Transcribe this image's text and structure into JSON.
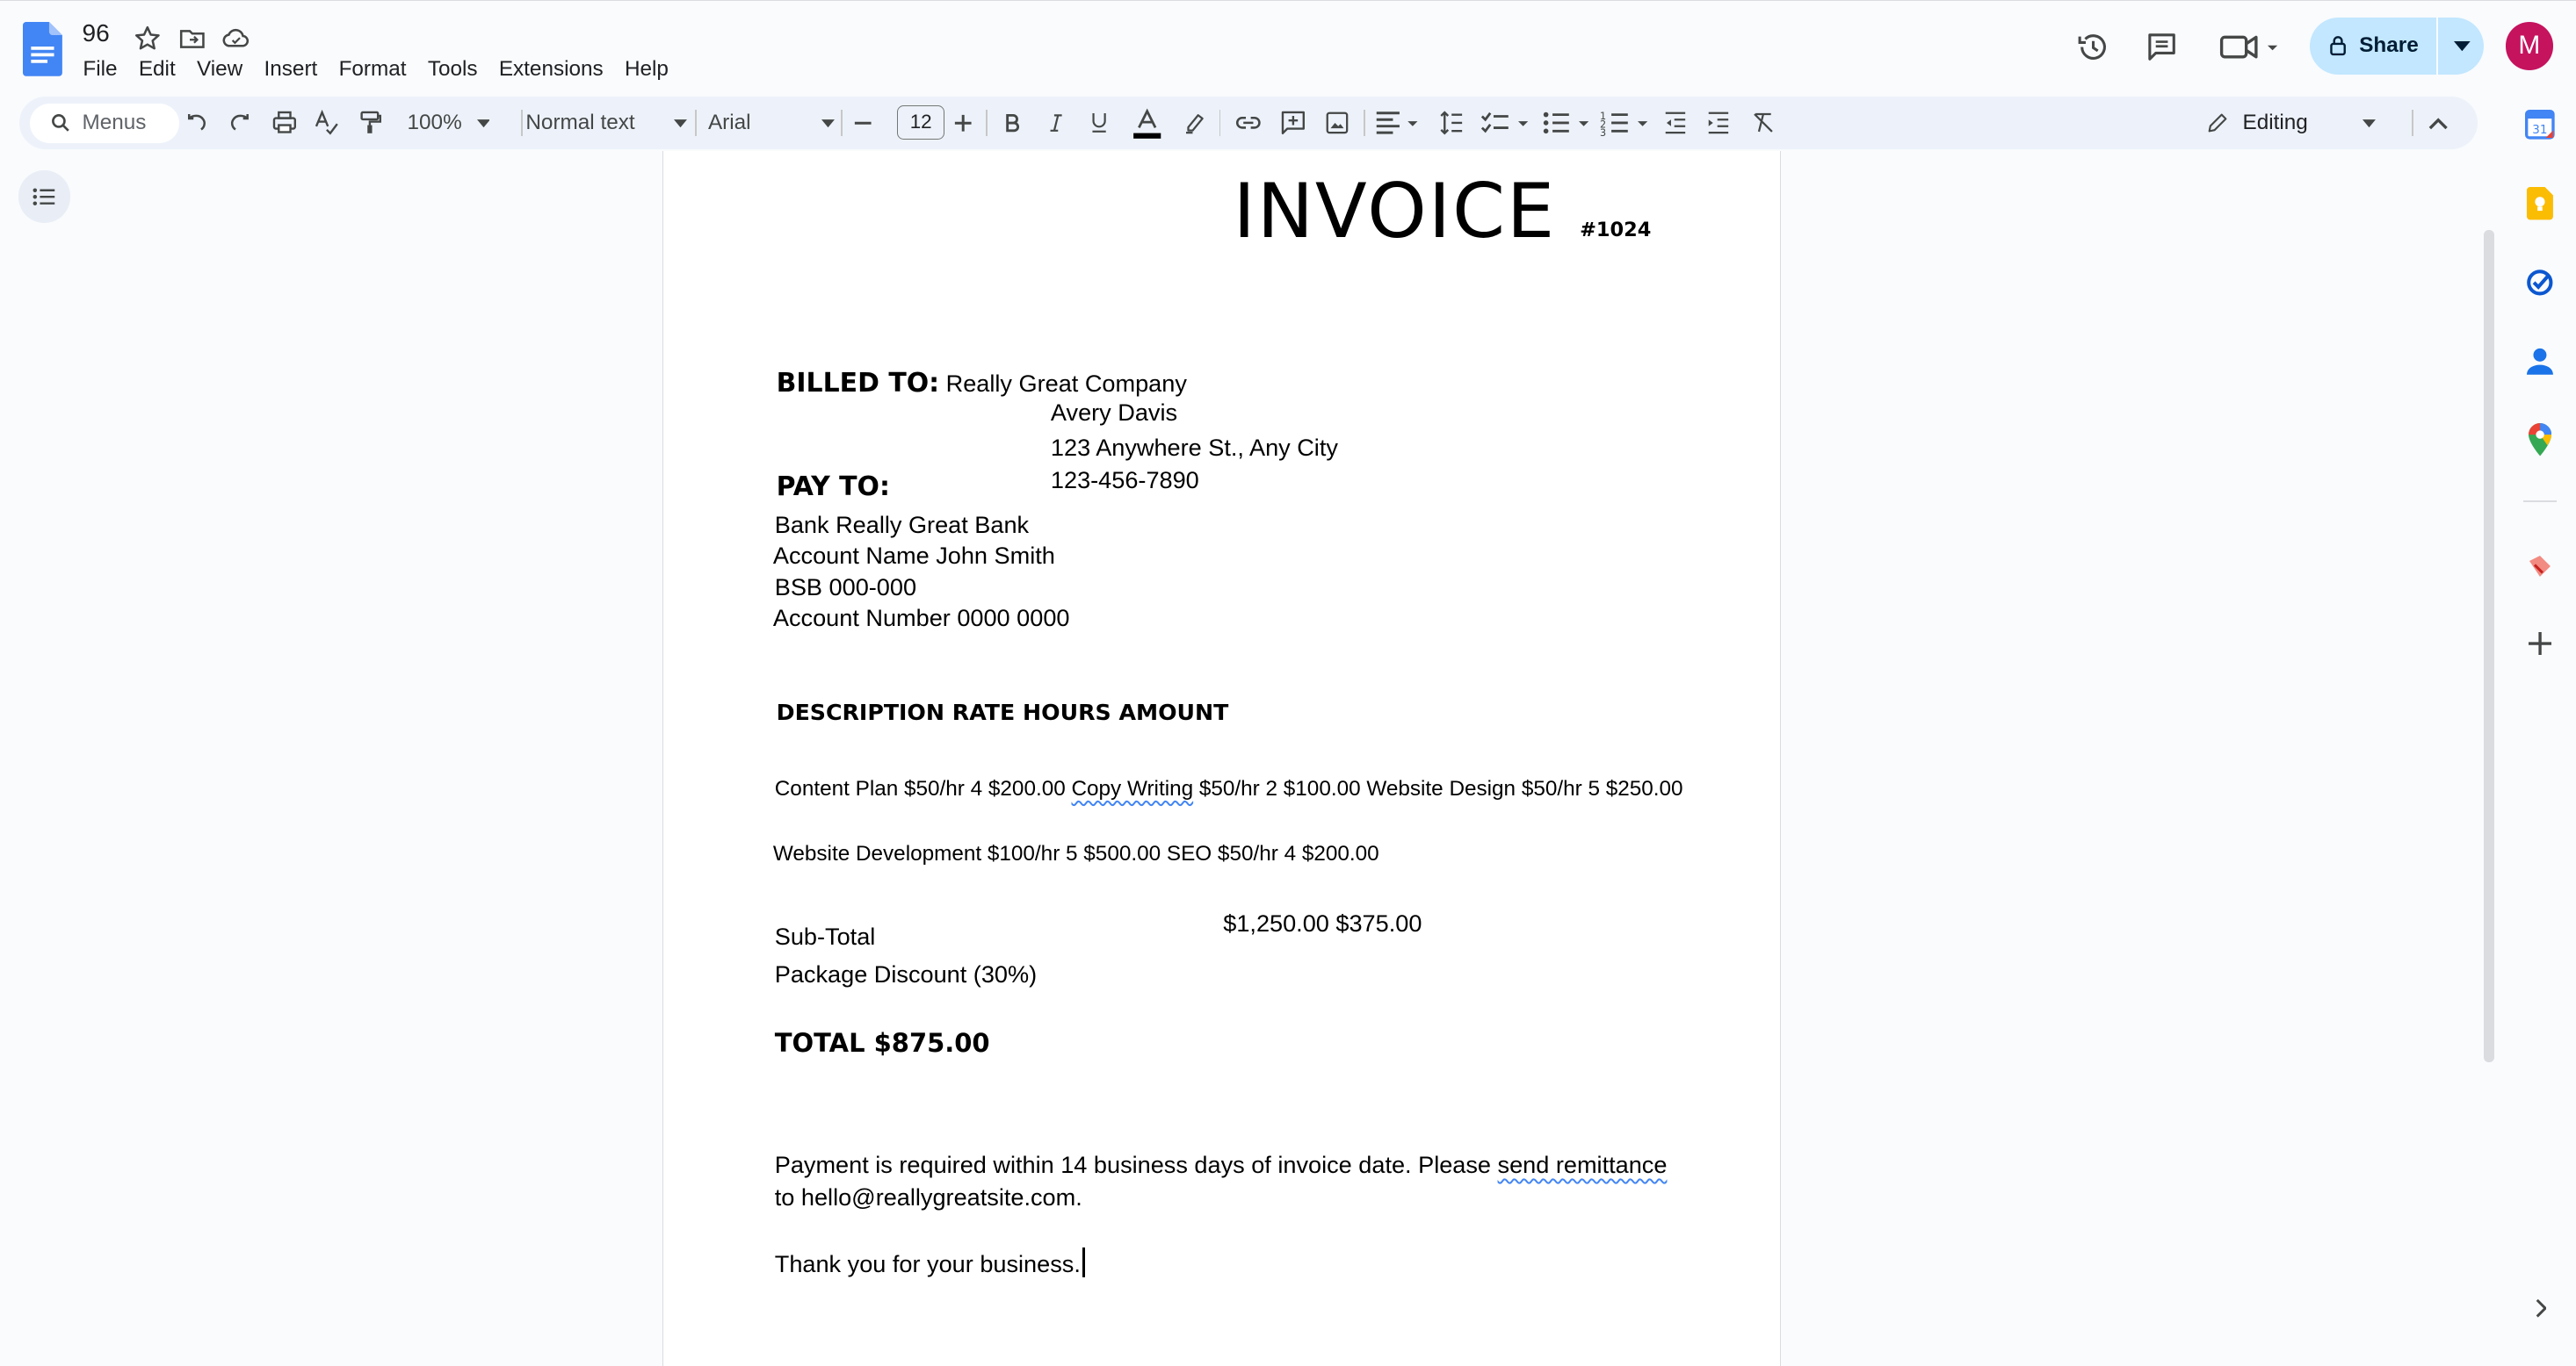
{
  "app": {
    "doc_title": "96",
    "menu": [
      "File",
      "Edit",
      "View",
      "Insert",
      "Format",
      "Tools",
      "Extensions",
      "Help"
    ],
    "share_label": "Share",
    "avatar_initial": "M",
    "colors": {
      "accent": "#c2e7ff",
      "avatar": "#c5135e",
      "docs_blue": "#4285f4"
    }
  },
  "toolbar": {
    "search_label": "Menus",
    "zoom": "100%",
    "style": "Normal text",
    "font": "Arial",
    "font_size": "12",
    "mode": "Editing",
    "icons": [
      "undo-icon",
      "redo-icon",
      "print-icon",
      "spellcheck-icon",
      "paint-format-icon",
      "bold-icon",
      "italic-icon",
      "underline-icon",
      "text-color-icon",
      "highlight-icon",
      "link-icon",
      "comment-icon",
      "image-icon",
      "align-icon",
      "line-spacing-icon",
      "checklist-icon",
      "bulleted-list-icon",
      "numbered-list-icon",
      "decrease-indent-icon",
      "increase-indent-icon",
      "clear-formatting-icon"
    ]
  },
  "document": {
    "title": "INVOICE",
    "number": "#1024",
    "billed_label": "BILLED TO:",
    "billed_company": "Really Great Company",
    "billed_name": "Avery Davis",
    "billed_address": "123 Anywhere St., Any City",
    "billed_phone": "123-456-7890",
    "pay_label": "PAY TO:",
    "pay_lines": [
      "Bank Really Great Bank",
      "Account Name John Smith",
      "BSB 000-000",
      "Account Number 0000 0000"
    ],
    "table_header": "DESCRIPTION RATE HOURS AMOUNT",
    "row1_a": "Content Plan $50/hr 4 $200.00 ",
    "row1_spell": "Copy Writing",
    "row1_b": " $50/hr 2 $100.00 Website Design $50/hr 5 $250.00",
    "row2": "Website Development $100/hr 5 $500.00 SEO $50/hr 4 $200.00",
    "totals_values": "$1,250.00 $375.00",
    "subtotal_label": "Sub-Total",
    "discount_label": "Package Discount (30%)",
    "total_line": "TOTAL $875.00",
    "payment_text_a": "Payment is required within 14 business days of invoice date. Please ",
    "payment_spell": "send remittance",
    "payment_text_b": "to hello@reallygreatsite.com.",
    "thanks": "Thank you for your business."
  }
}
